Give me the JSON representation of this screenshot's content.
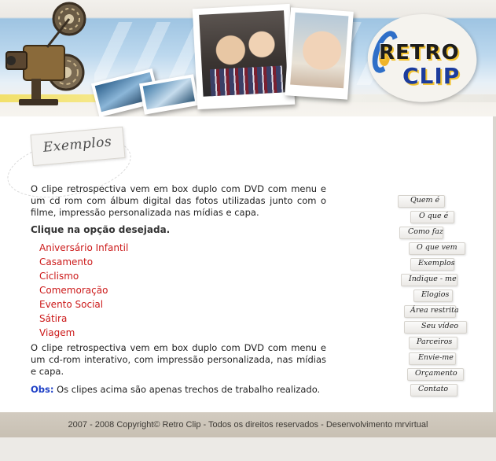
{
  "header": {
    "logo_line1": "RETRO",
    "logo_line2": "CLIP"
  },
  "section": {
    "title": "Exemplos"
  },
  "content": {
    "intro": "O clipe retrospectiva vem em box duplo com DVD com menu e um cd rom com álbum digital das fotos utilizadas junto com o filme, impressão personalizada nas mídias e capa.",
    "prompt": "Clique na opção desejada.",
    "options": [
      "Aniversário Infantil",
      "Casamento",
      "Ciclismo",
      "Comemoração",
      "Evento Social",
      "Sátira",
      "Viagem"
    ],
    "outro": "O clipe retrospectiva vem em box duplo com DVD com menu e um cd-rom interativo, com impressão personalizada, nas mídias e capa.",
    "note_label": "Obs:",
    "note_text": " Os clipes acima são apenas trechos de trabalho realizado."
  },
  "nav": {
    "items": [
      "Quem é",
      "O que é",
      "Como faz",
      "O que vem",
      "Exemplos",
      "Indique - me",
      "Elogios",
      "Área restrita",
      "Seu vídeo",
      "Parceiros",
      "Envie-me",
      "Orçamento",
      "Contato"
    ]
  },
  "footer": {
    "text": "2007 - 2008 Copyright©   Retro Clip  -  Todos os direitos reservados  - Desenvolvimento mrvirtual"
  },
  "colors": {
    "option_link": "#cc1a1a",
    "note_label": "#1d3fc6",
    "footer_bg": "#cfc8bc"
  }
}
